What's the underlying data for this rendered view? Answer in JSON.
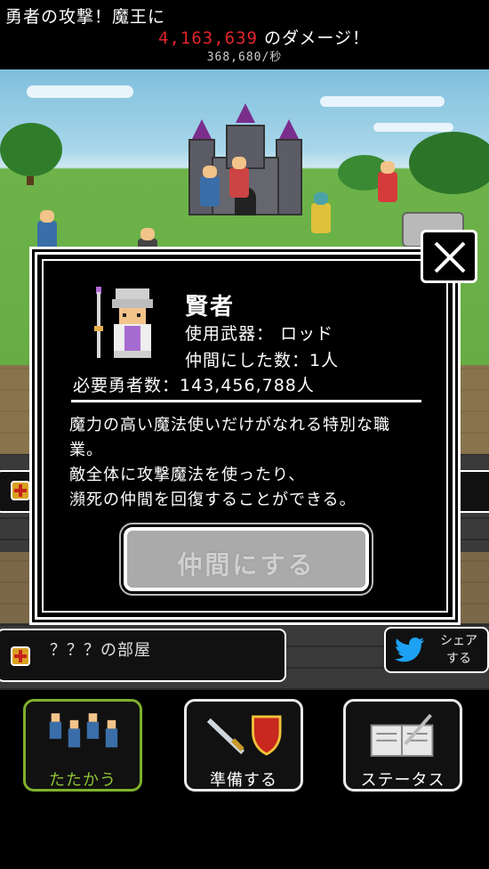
{
  "header": {
    "line1": "勇者の攻撃！魔王に",
    "damage": "4,163,639",
    "damage_suffix": "のダメージ！",
    "rate": "368,680/秒",
    "damage_color": "#e2242b"
  },
  "side_bars": {
    "room_label": "？？？の部屋"
  },
  "share": {
    "line1": "シェア",
    "line2": "する",
    "icon": "twitter-bird-icon"
  },
  "nav": {
    "fight_label": "たたかう",
    "equip_label": "準備する",
    "status_label": "ステータス"
  },
  "modal": {
    "job_name": "賢者",
    "weapon_label": "使用武器：",
    "weapon_value": "ロッド",
    "party_label": "仲間にした数：",
    "party_value": "1人",
    "required_label": "必要勇者数：",
    "required_value": "143,456,788人",
    "description": [
      "魔力の高い魔法使いだけがなれる特別な職",
      "業。",
      "敵全体に攻撃魔法を使ったり、",
      "瀕死の仲間を回復することができる。"
    ],
    "recruit_button": "仲間にする",
    "recruit_enabled": false,
    "close_icon": "close-icon"
  },
  "colors": {
    "accent_green": "#8fc334",
    "disabled_button": "#aaaaaa"
  }
}
